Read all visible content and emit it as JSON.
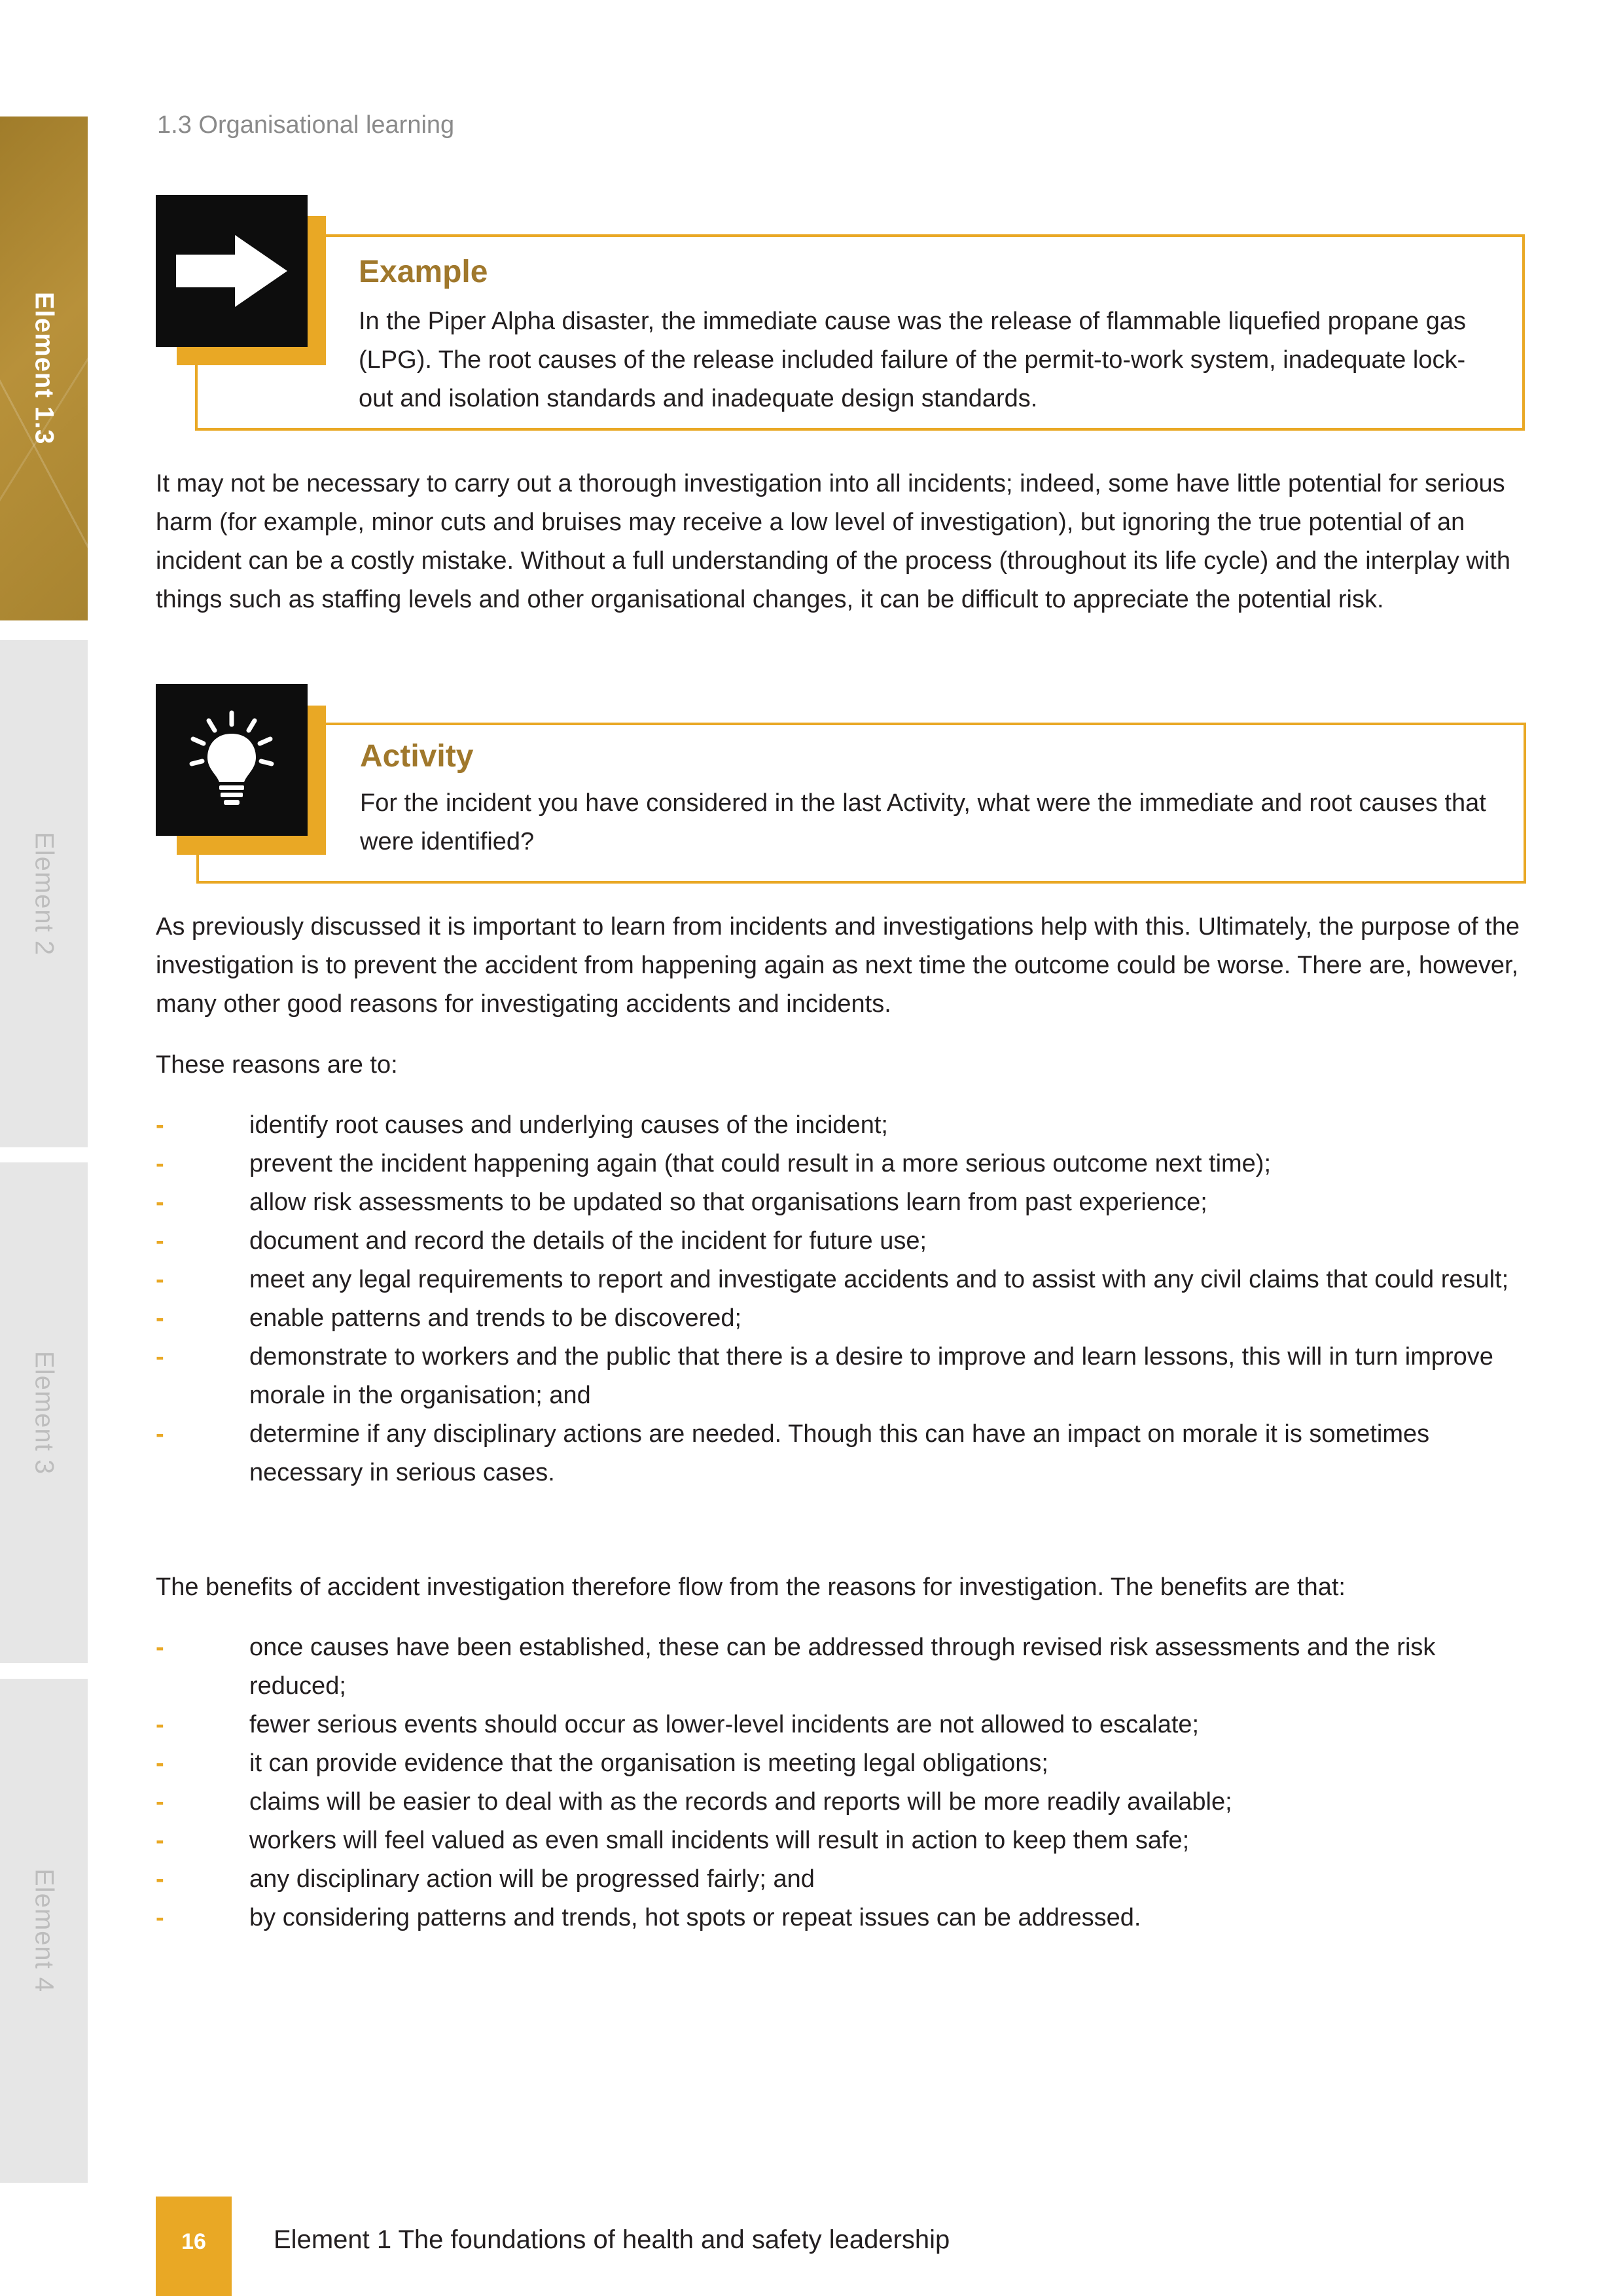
{
  "side_tabs": {
    "active": "Element 1.3",
    "element2": "Element 2",
    "element3": "Element 3",
    "element4": "Element 4"
  },
  "header": {
    "section": "1.3  Organisational learning"
  },
  "example": {
    "icon": "arrow-right-icon",
    "title": "Example",
    "body": "In the Piper Alpha disaster, the immediate cause was the release of flammable liquefied propane gas (LPG). The root causes of the release included failure of the permit-to-work system, inadequate lock-out and isolation standards and inadequate design standards."
  },
  "paragraphs": {
    "p1": "It may not be necessary to carry out a thorough investigation into all incidents; indeed, some have little potential for serious harm (for example, minor cuts and bruises may receive a low level of investigation), but ignoring the true potential of an incident can be a costly mistake. Without a full understanding of the process (throughout its life cycle) and the interplay with things such as staffing levels and other organisational changes, it can be difficult to appreciate the potential risk.",
    "p2": "As previously discussed it is important to learn from incidents and investigations help with this. Ultimately, the purpose of the investigation is to prevent the accident from happening again as next time the outcome could be worse. There are, however, many other good reasons for investigating accidents and incidents.",
    "p3": "These reasons are to:",
    "p4": "The benefits of accident investigation therefore flow from the reasons for investigation. The benefits are that:"
  },
  "activity": {
    "icon": "lightbulb-icon",
    "title": "Activity",
    "body": "For the incident you have considered in the last Activity, what were the immediate and root causes that were identified?"
  },
  "bullet_marker": "-",
  "reasons": [
    "identify root causes and underlying causes of the incident;",
    "prevent the incident happening again (that could result in a more serious outcome next time);",
    "allow risk assessments to be updated so that organisations learn from past experience;",
    "document and record the details of the incident for future use;",
    "meet any legal requirements to report and investigate accidents and to assist with any civil claims that could result;",
    "enable patterns and trends to be discovered;",
    "demonstrate to workers and the public that there is a desire to improve and learn lessons, this will in turn improve morale in the organisation; and",
    "determine if any disciplinary actions are needed. Though this can have an impact on morale it is sometimes necessary in serious cases."
  ],
  "benefits": [
    "once causes have been established, these can be addressed through revised risk assessments and the risk reduced;",
    "fewer serious events should occur as lower-level incidents are not allowed to escalate;",
    "it can provide evidence that the organisation is meeting legal obligations;",
    "claims will be easier to deal with as the records and reports will be more readily available;",
    "workers will feel valued as even small incidents will result in action to keep them safe;",
    "any disciplinary action will be progressed fairly; and",
    "by considering patterns and trends, hot spots or repeat issues can be addressed."
  ],
  "footer": {
    "page_number": "16",
    "title": "Element 1 The foundations of health and safety leadership"
  },
  "colors": {
    "accent": "#e9a825",
    "heading": "#a0782c",
    "active_tab": "#a88430",
    "inactive_tab": "#e6e6e6"
  }
}
